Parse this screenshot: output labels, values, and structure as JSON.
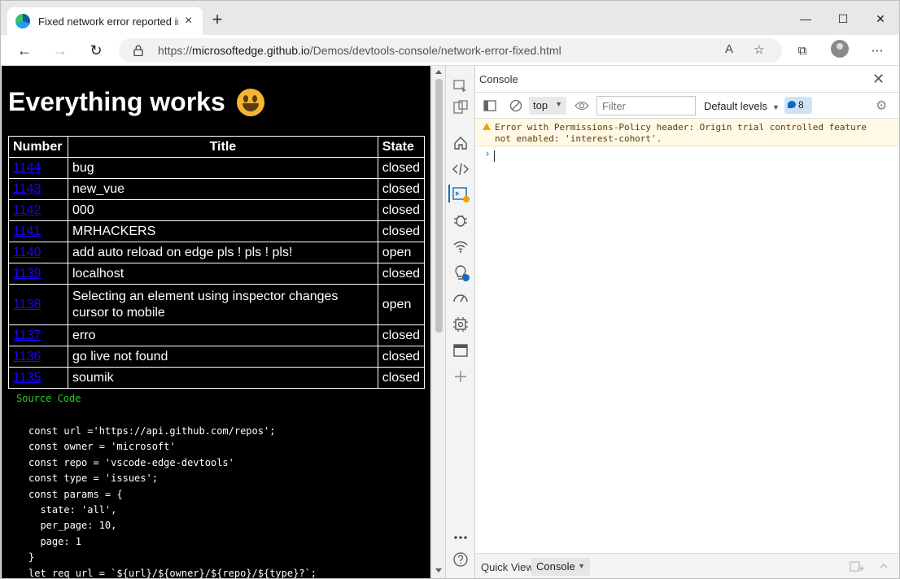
{
  "browser": {
    "tab_title": "Fixed network error reported in C",
    "new_tab": "+",
    "url_prefix": "https://",
    "url_host": "microsoftedge.github.io",
    "url_path": "/Demos/devtools-console/network-error-fixed.html",
    "icons": {
      "back": "←",
      "forward": "→",
      "refresh": "↻",
      "read_aloud": "A",
      "favorites": "☆",
      "collections": "⧉",
      "more": "⋯",
      "minimize": "—",
      "maximize": "☐",
      "close": "✕",
      "tab_close": "×"
    }
  },
  "page": {
    "heading": "Everything works",
    "table": {
      "headers": [
        "Number",
        "Title",
        "State"
      ],
      "rows": [
        {
          "number": "1144",
          "title": "bug",
          "state": "closed"
        },
        {
          "number": "1143",
          "title": "new_vue",
          "state": "closed"
        },
        {
          "number": "1142",
          "title": "000",
          "state": "closed"
        },
        {
          "number": "1141",
          "title": "MRHACKERS",
          "state": "closed"
        },
        {
          "number": "1140",
          "title": "add auto reload on edge pls ! pls ! pls!",
          "state": "open"
        },
        {
          "number": "1139",
          "title": "localhost",
          "state": "closed"
        },
        {
          "number": "1138",
          "title": "Selecting an element using inspector changes cursor to mobile",
          "state": "open"
        },
        {
          "number": "1137",
          "title": "erro",
          "state": "closed"
        },
        {
          "number": "1136",
          "title": "go live not found",
          "state": "closed"
        },
        {
          "number": "1135",
          "title": "soumik",
          "state": "closed"
        }
      ]
    },
    "source_label": "Source Code",
    "code": "const url ='https://api.github.com/repos';\nconst owner = 'microsoft'\nconst repo = 'vscode-edge-devtools'\nconst type = 'issues';\nconst params = {\n  state: 'all',\n  per_page: 10,\n  page: 1\n}\nlet req_url = `${url}/${owner}/${repo}/${type}?`;"
  },
  "devtools": {
    "panel_title": "Console",
    "close": "✕",
    "context": "top",
    "filter_placeholder": "Filter",
    "levels": "Default levels",
    "issues_count": "8",
    "warning_line1": "Error with Permissions-Policy header: Origin trial controlled feature",
    "warning_line2": "not enabled: 'interest-cohort'.",
    "prompt": "›",
    "quick_view_label": "Quick View:",
    "quick_view_value": "Console",
    "colors": {
      "accent": "#0f6cbd",
      "warning_bg": "#fff9e5",
      "link": "#1a00ff",
      "code_label": "#27d027"
    }
  }
}
